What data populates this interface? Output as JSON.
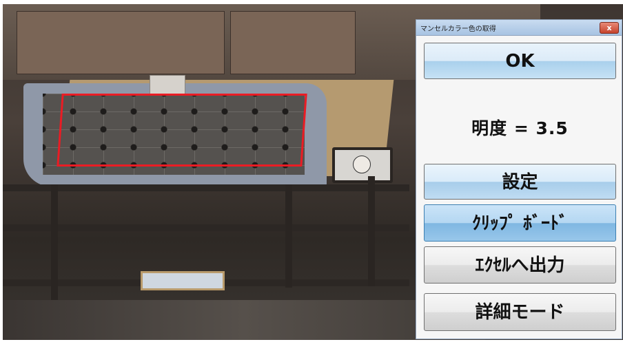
{
  "dialog": {
    "title": "マンセルカラー色の取得",
    "close_label": "x",
    "ok_label": "OK",
    "brightness_text": "明度 = 3.5",
    "setting_label": "設定",
    "clipboard_label": "ｸﾘｯﾌﾟ ﾎﾞｰﾄﾞ",
    "excel_label": "ｴｸｾﾙへ出力",
    "detail_label": "詳細モード"
  },
  "colors": {
    "selection_frame": "#ea1c24",
    "button_blue": "#bfdcf3",
    "button_active": "#98c7ea",
    "button_gray": "#dddddd"
  }
}
